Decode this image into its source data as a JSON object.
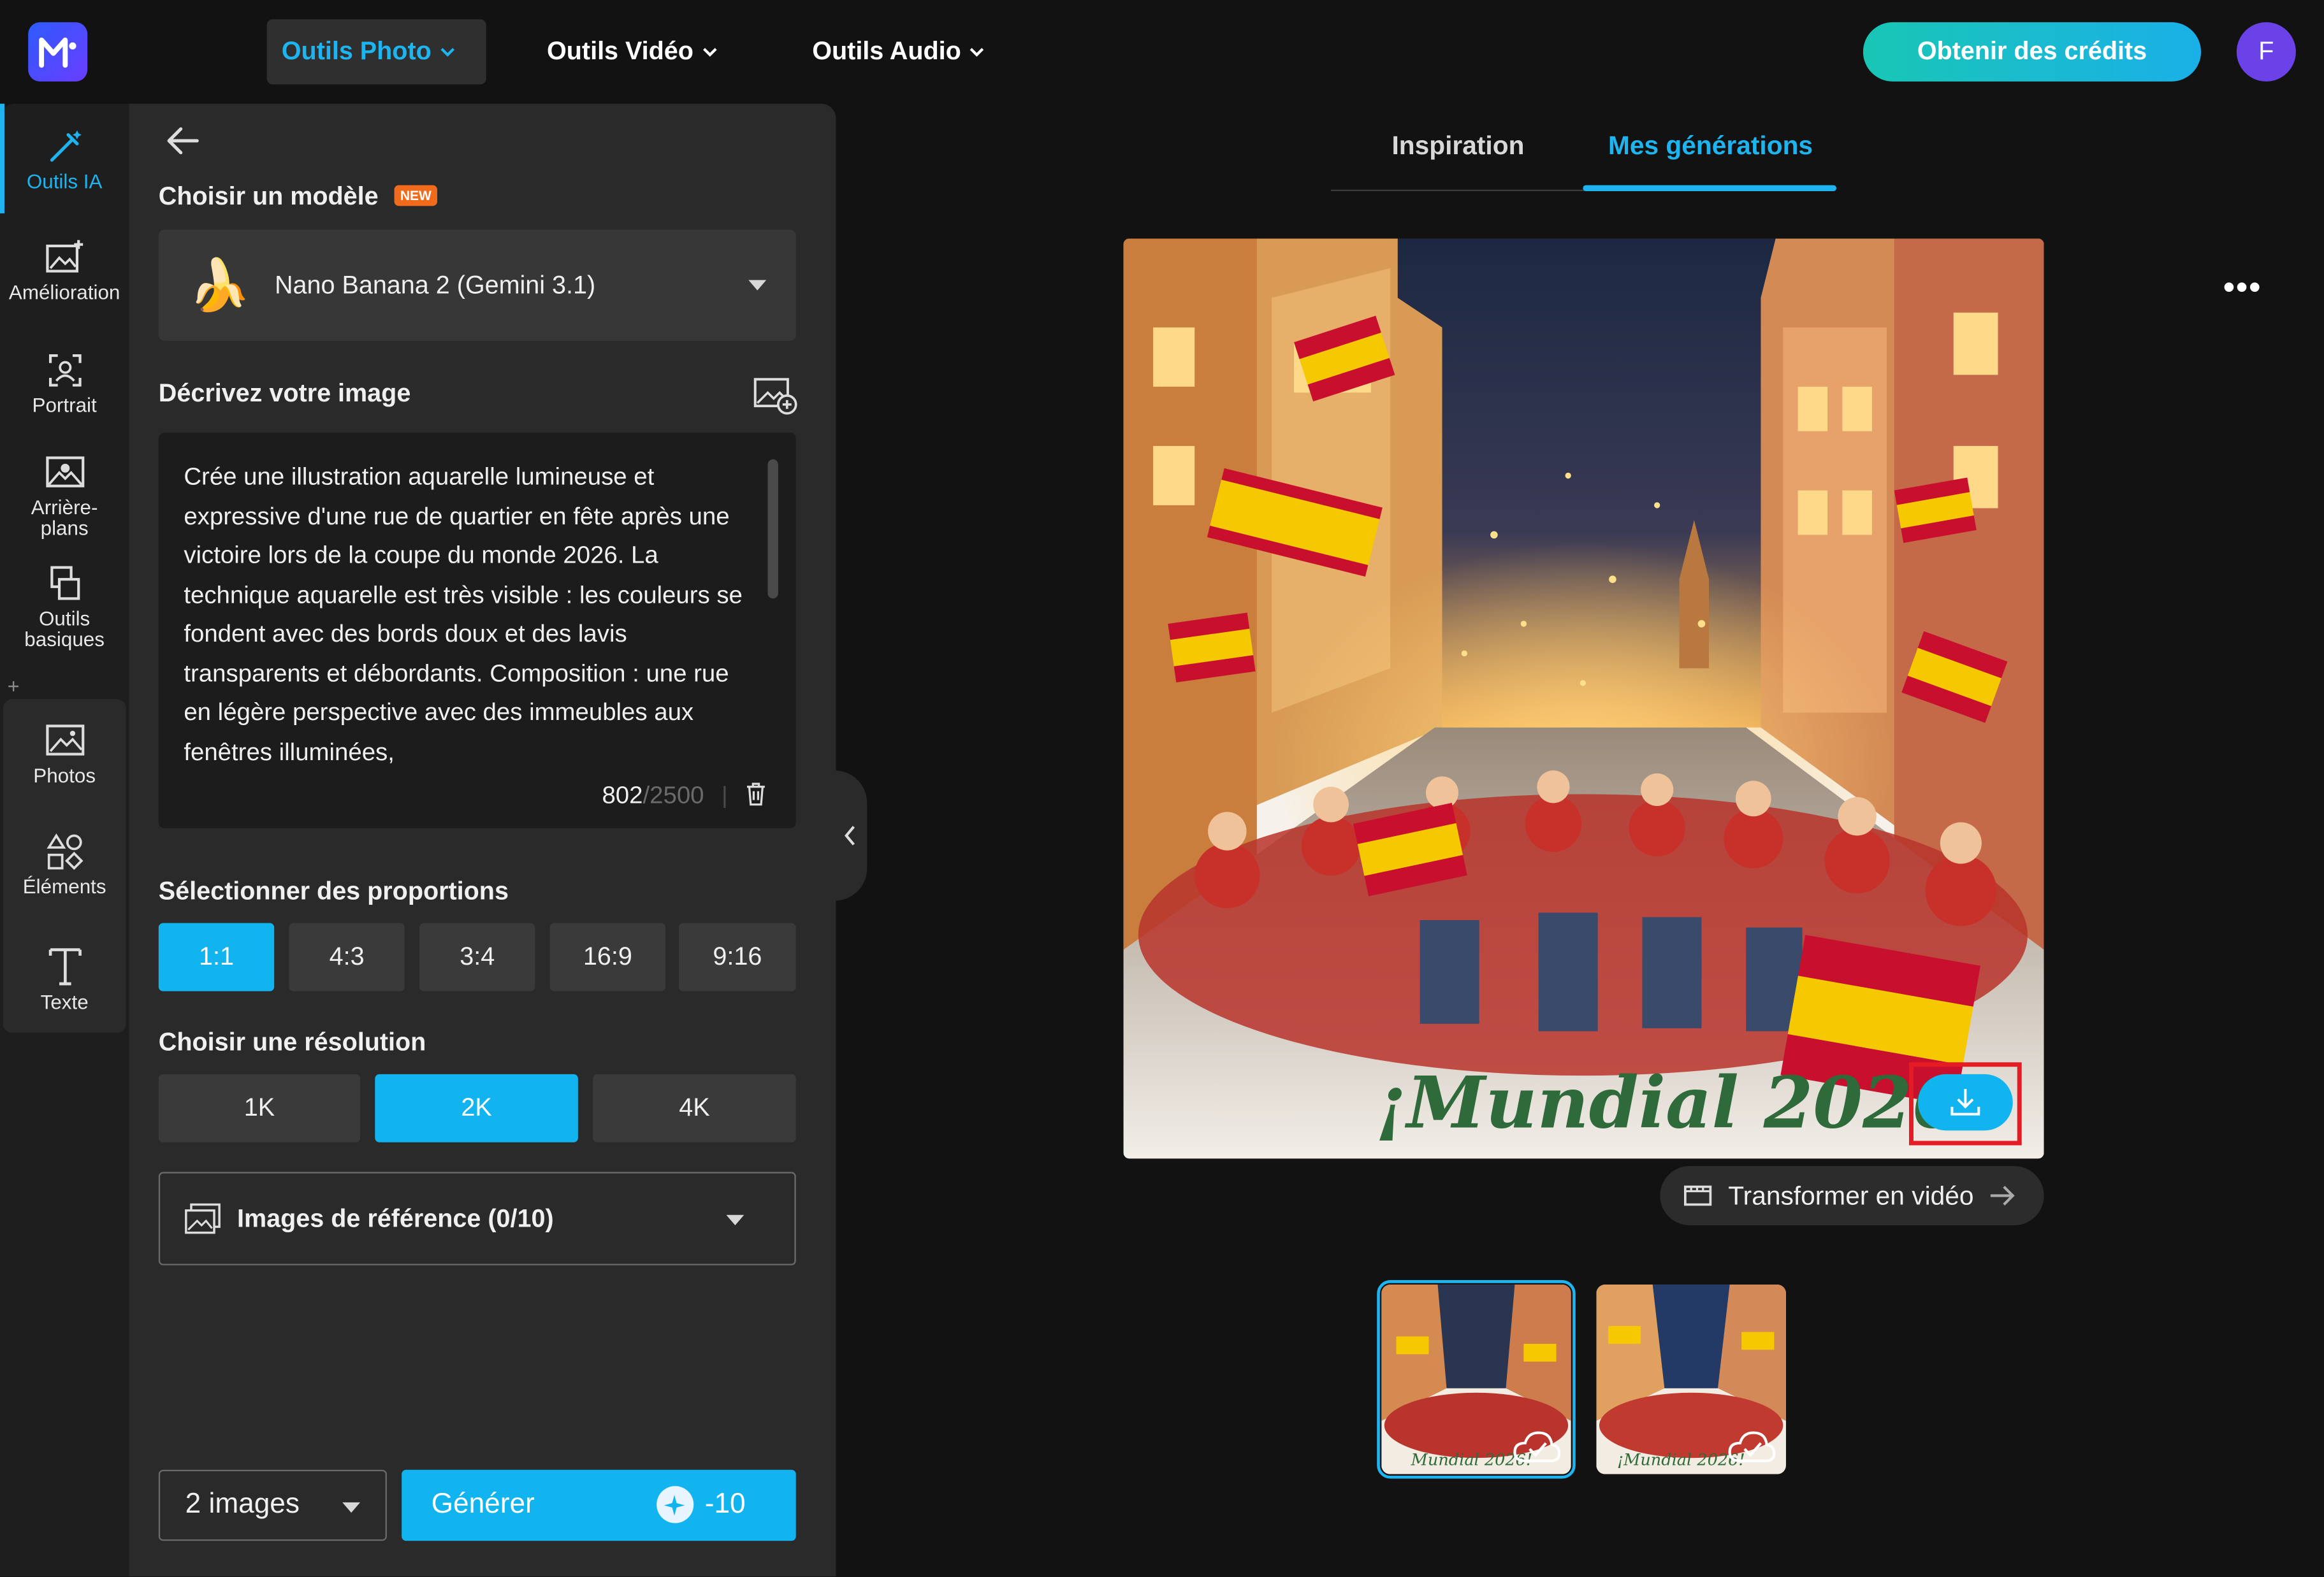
{
  "header": {
    "nav": [
      {
        "label": "Outils Photo"
      },
      {
        "label": "Outils Vidéo"
      },
      {
        "label": "Outils Audio"
      }
    ],
    "credits_button": "Obtenir des crédits",
    "avatar_initial": "F"
  },
  "rail": {
    "items": [
      {
        "label": "Outils IA",
        "icon": "magic-wand-icon"
      },
      {
        "label": "Amélioration",
        "icon": "image-enhance-icon"
      },
      {
        "label": "Portrait",
        "icon": "portrait-icon"
      },
      {
        "label": "Arrière-plans",
        "icon": "background-icon"
      },
      {
        "label": "Outils basiques",
        "icon": "copy-icon"
      },
      {
        "label": "Photos",
        "icon": "image-icon"
      },
      {
        "label": "Éléments",
        "icon": "shapes-icon"
      },
      {
        "label": "Texte",
        "icon": "text-icon"
      }
    ],
    "add_label": "+"
  },
  "panel": {
    "model_title": "Choisir un modèle",
    "new_badge": "NEW",
    "model_selected": "Nano Banana 2 (Gemini 3.1)",
    "model_emoji": "🍌",
    "describe_title": "Décrivez votre image",
    "prompt_text": "Crée une illustration aquarelle lumineuse et expressive d'une rue de quartier en fête après une victoire lors de la coupe du monde 2026. La technique aquarelle est très visible : les couleurs se fondent avec des bords doux et des lavis transparents et débordants. Composition : une rue en légère perspective avec des immeubles aux fenêtres illuminées,",
    "char_count": "802",
    "char_max": "/2500",
    "char_sep": "|",
    "ratio_title": "Sélectionner des proportions",
    "ratios": [
      "1:1",
      "4:3",
      "3:4",
      "16:9",
      "9:16"
    ],
    "ratio_selected": "1:1",
    "resolution_title": "Choisir une résolution",
    "resolutions": [
      "1K",
      "2K",
      "4K"
    ],
    "resolution_selected": "2K",
    "reference_label": "Images de référence (0/10)",
    "image_count": "2 images",
    "generate_label": "Générer",
    "generate_cost": "-10"
  },
  "main": {
    "tabs": [
      {
        "label": "Inspiration"
      },
      {
        "label": "Mes générations"
      }
    ],
    "active_tab": "Mes générations",
    "image_caption": "¡Mundial 2026!",
    "more_menu": "•••",
    "to_video_label": "Transformer en vidéo",
    "thumb_captions": [
      "Mundial 2026!",
      "¡Mundial 2026!"
    ]
  },
  "colors": {
    "accent": "#12b4ef",
    "background": "#121212",
    "panel": "#2a2a2a",
    "highlight": "#e51c23"
  }
}
